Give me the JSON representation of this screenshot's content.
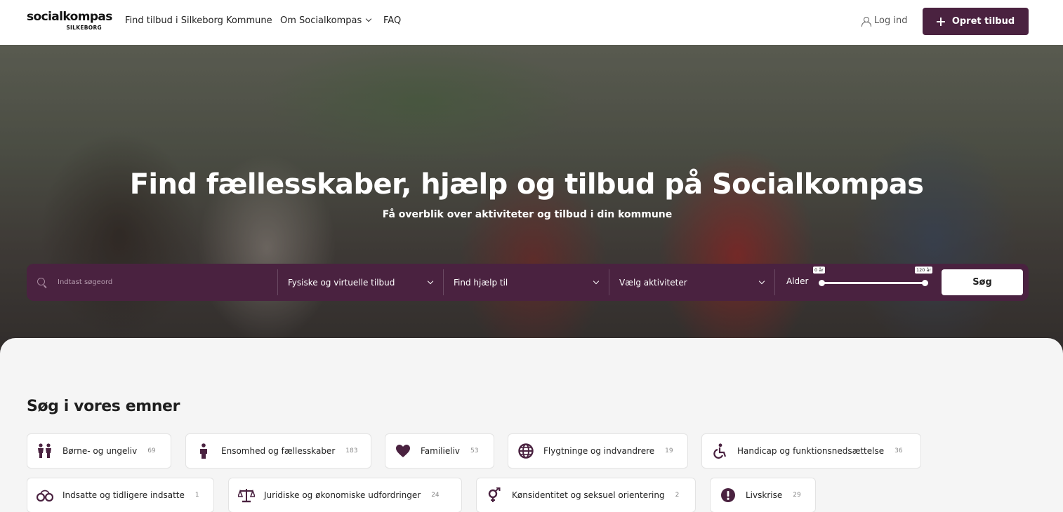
{
  "header": {
    "logo_main": "socialkompas",
    "logo_sub": "SILKEBORG",
    "nav": [
      "Find tilbud i Silkeborg Kommune",
      "Om Socialkompas",
      "FAQ"
    ],
    "login_label": "Log ind",
    "create_label": "Opret tilbud"
  },
  "hero": {
    "title": "Find fællesskaber, hjælp og tilbud på Socialkompas",
    "subtitle": "Få overblik over aktiviteter og tilbud i din kommune"
  },
  "search": {
    "placeholder": "Indtast søgeord",
    "dropdown_1": "Fysiske og virtuelle tilbud",
    "dropdown_2": "Find hjælp til",
    "dropdown_3": "Vælg aktiviteter",
    "age_label": "Alder",
    "age_min": "0 år",
    "age_max": "120 år",
    "button": "Søg"
  },
  "topics": {
    "title": "Søg i vores emner",
    "items": [
      {
        "label": "Børne- og ungeliv",
        "count": "69",
        "icon": "children-icon"
      },
      {
        "label": "Ensomhed og fællesskaber",
        "count": "183",
        "icon": "person-icon"
      },
      {
        "label": "Familieliv",
        "count": "53",
        "icon": "heart-icon"
      },
      {
        "label": "Flygtninge og indvandrere",
        "count": "19",
        "icon": "globe-icon"
      },
      {
        "label": "Handicap og funktionsnedsættelse",
        "count": "36",
        "icon": "wheelchair-icon"
      },
      {
        "label": "Indsatte og tidligere indsatte",
        "count": "1",
        "icon": "handcuffs-icon"
      },
      {
        "label": "Juridiske og økonomiske udfordringer",
        "count": "24",
        "icon": "scales-icon"
      },
      {
        "label": "Kønsidentitet og seksuel orientering",
        "count": "2",
        "icon": "gender-icon"
      },
      {
        "label": "Livskrise",
        "count": "29",
        "icon": "exclamation-icon"
      }
    ]
  },
  "colors": {
    "brand": "#4a2240",
    "icon": "#4a2240"
  }
}
